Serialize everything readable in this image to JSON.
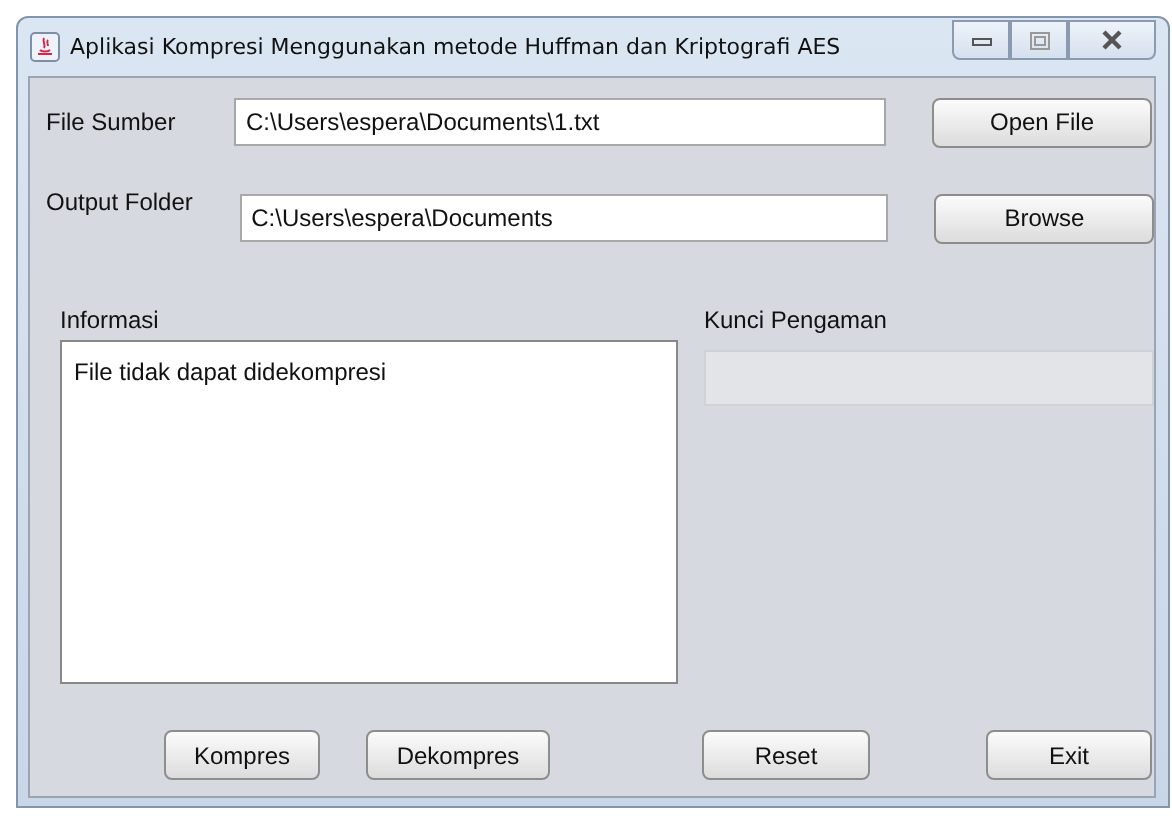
{
  "window": {
    "title": "Aplikasi Kompresi Menggunakan metode Huffman dan Kriptografi AES"
  },
  "fields": [
    {
      "label": "File Sumber",
      "value": "C:\\Users\\espera\\Documents\\1.txt",
      "button": "Open File"
    },
    {
      "label": "Output Folder",
      "value": "C:\\Users\\espera\\Documents",
      "button": "Browse"
    }
  ],
  "informasi": {
    "label": "Informasi",
    "text": "File tidak dapat didekompresi"
  },
  "kunci": {
    "label": "Kunci Pengaman",
    "disabled": true
  },
  "buttons": [
    "Kompres",
    "Dekompres",
    "Reset",
    "Exit"
  ]
}
